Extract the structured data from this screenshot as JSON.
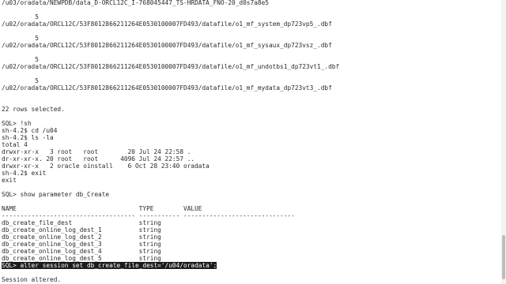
{
  "terminal": {
    "lines": [
      "/u03/oradata/NEWPDB/data_D-ORCL12C_I-768045447_TS-HRDATA_FNO-20_d0s7a8e5",
      "",
      "         5",
      "/u02/oradata/ORCL12C/53F8012866211264E0530100007FD493/datafile/o1_mf_system_dp723vp5_.dbf",
      "",
      "         5",
      "/u02/oradata/ORCL12C/53F8012866211264E0530100007FD493/datafile/o1_mf_sysaux_dp723vsz_.dbf",
      "",
      "         5",
      "/u02/oradata/ORCL12C/53F8012866211264E0530100007FD493/datafile/o1_mf_undotbs1_dp723vt1_.dbf",
      "",
      "         5",
      "/u02/oradata/ORCL12C/53F8012866211264E0530100007FD493/datafile/o1_mf_mydata_dp723vt3_.dbf",
      "",
      "",
      "22 rows selected.",
      "",
      "SQL> !sh",
      "sh-4.2$ cd /u04",
      "sh-4.2$ ls -la",
      "total 4",
      "drwxr-xr-x   3 root   root        20 Jul 24 22:58 .",
      "dr-xr-xr-x. 20 root   root      4096 Jul 24 22:57 ..",
      "drwxr-xr-x   2 oracle oinstall    6 Oct 28 23:40 oradata",
      "sh-4.2$ exit",
      "exit",
      "",
      "SQL> show parameter db_Create",
      "",
      "NAME                                 TYPE        VALUE",
      "------------------------------------ ----------- ------------------------------",
      "db_create_file_dest                  string",
      "db_create_online_log_dest_1          string",
      "db_create_online_log_dest_2          string",
      "db_create_online_log_dest_3          string",
      "db_create_online_log_dest_4          string",
      "db_create_online_log_dest_5          string"
    ],
    "selected_line": "SQL> alter session set db_create_file_dest='/u04/oradata';",
    "trailing_lines": [
      "",
      "Session altered."
    ]
  }
}
